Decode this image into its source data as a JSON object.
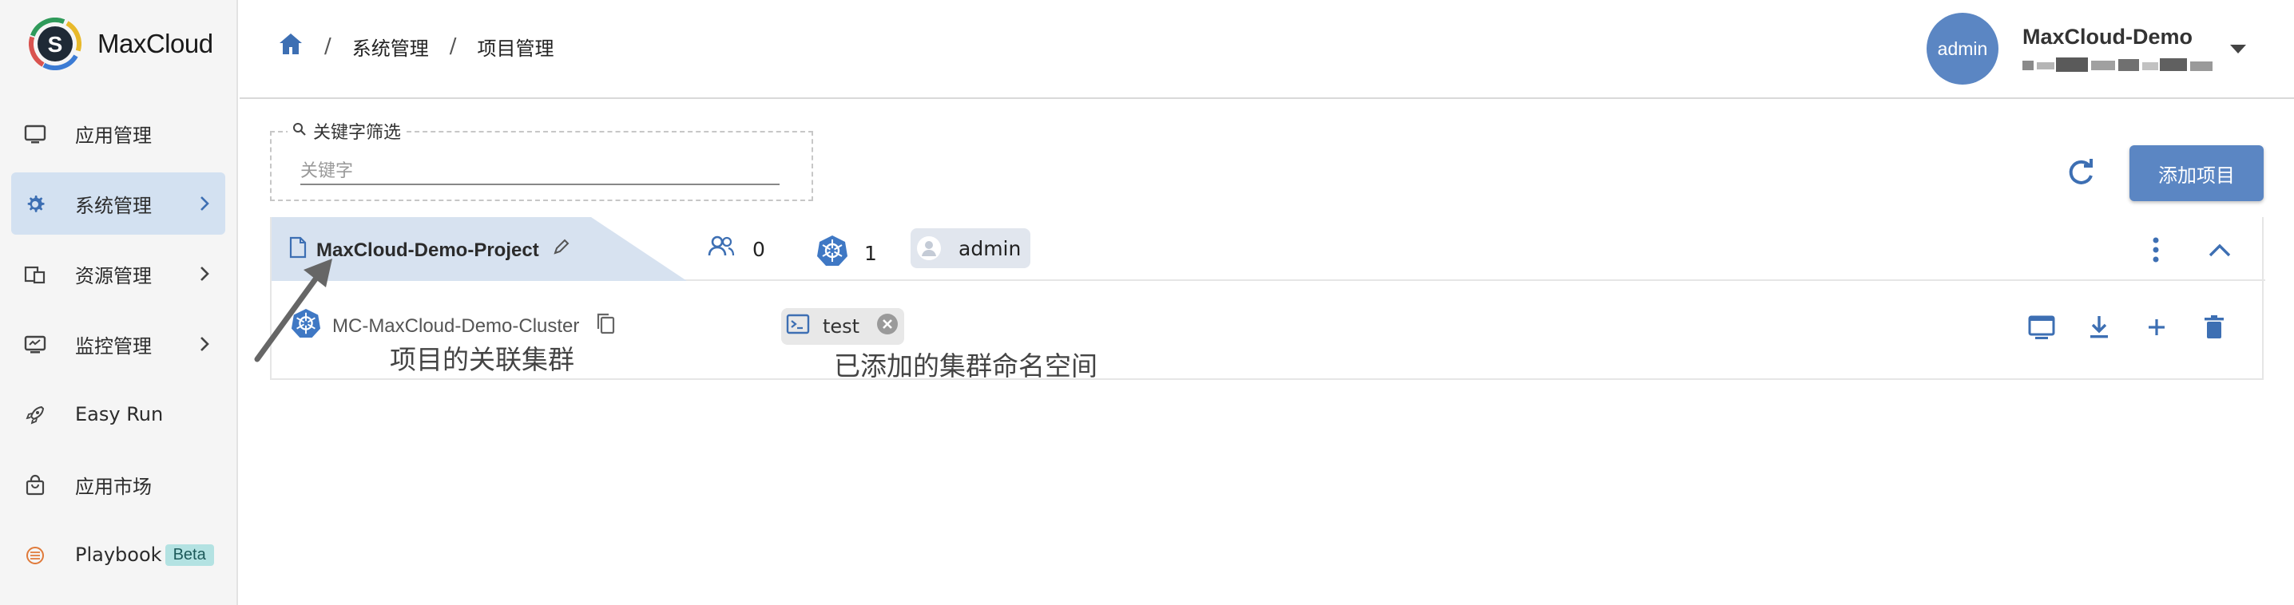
{
  "brand": {
    "name": "MaxCloud",
    "logo_letter": "S"
  },
  "sidebar": {
    "items": [
      {
        "label": "应用管理",
        "icon": "monitor-icon",
        "active": false,
        "chevron": false
      },
      {
        "label": "系统管理",
        "icon": "gear-icon",
        "active": true,
        "chevron": true
      },
      {
        "label": "资源管理",
        "icon": "resources-icon",
        "active": false,
        "chevron": true
      },
      {
        "label": "监控管理",
        "icon": "monitoring-icon",
        "active": false,
        "chevron": true
      },
      {
        "label": "Easy Run",
        "icon": "rocket-icon",
        "active": false,
        "chevron": false
      },
      {
        "label": "应用市场",
        "icon": "shopping-bag-icon",
        "active": false,
        "chevron": false
      },
      {
        "label": "Playbook",
        "icon": "playbook-icon",
        "active": false,
        "chevron": false,
        "badge": "Beta"
      }
    ]
  },
  "header": {
    "breadcrumbs": [
      "系统管理",
      "项目管理"
    ],
    "separator": "/",
    "user": {
      "avatar_text": "admin",
      "name": "MaxCloud-Demo"
    }
  },
  "filter": {
    "legend": "关键字筛选",
    "placeholder": "关键字",
    "value": ""
  },
  "toolbar": {
    "add_label": "添加项目"
  },
  "project": {
    "name": "MaxCloud-Demo-Project",
    "member_count": "0",
    "cluster_count": "1",
    "owner": "admin",
    "cluster": {
      "name": "MC-MaxCloud-Demo-Cluster",
      "namespace": "test"
    }
  },
  "annotations": {
    "cluster_note": "项目的关联集群",
    "namespace_note": "已添加的集群命名空间"
  },
  "colors": {
    "primary": "#5b86c3",
    "active_bg": "#d3e1f1",
    "tab_bg": "#d7e2f0",
    "k8s": "#3f78c4",
    "chip_bg": "#e1e6ee"
  }
}
